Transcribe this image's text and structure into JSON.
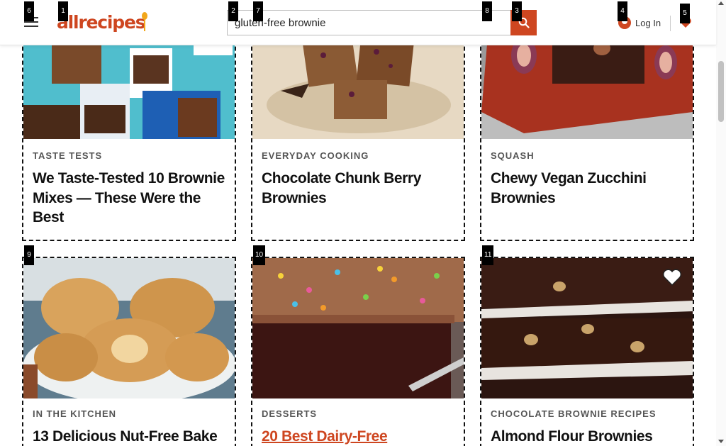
{
  "site": {
    "logo_text": "allrecipes",
    "brand_color": "#ce4620"
  },
  "header": {
    "menu_icon": "hamburger-menu-icon",
    "search": {
      "value": "gluten-free brownie",
      "button_icon": "search-icon"
    },
    "login_label": "Log In",
    "saved_icon": "heart-icon"
  },
  "annotations": [
    "1",
    "2",
    "3",
    "4",
    "5",
    "6",
    "7",
    "8",
    "9",
    "10",
    "11"
  ],
  "cards": [
    {
      "tag": "TASTE TESTS",
      "title": "We Taste-Tested 10 Brownie Mixes — These Were the Best"
    },
    {
      "tag": "EVERYDAY COOKING",
      "title": "Chocolate Chunk Berry Brownies"
    },
    {
      "tag": "SQUASH",
      "title": "Chewy Vegan Zucchini Brownies"
    },
    {
      "tag": "IN THE KITCHEN",
      "title": "13 Delicious Nut-Free Bake"
    },
    {
      "tag": "DESSERTS",
      "title": "20 Best Dairy-Free"
    },
    {
      "tag": "CHOCOLATE BROWNIE RECIPES",
      "title": "Almond Flour Brownies",
      "save_icon": "heart-outline-icon"
    }
  ]
}
